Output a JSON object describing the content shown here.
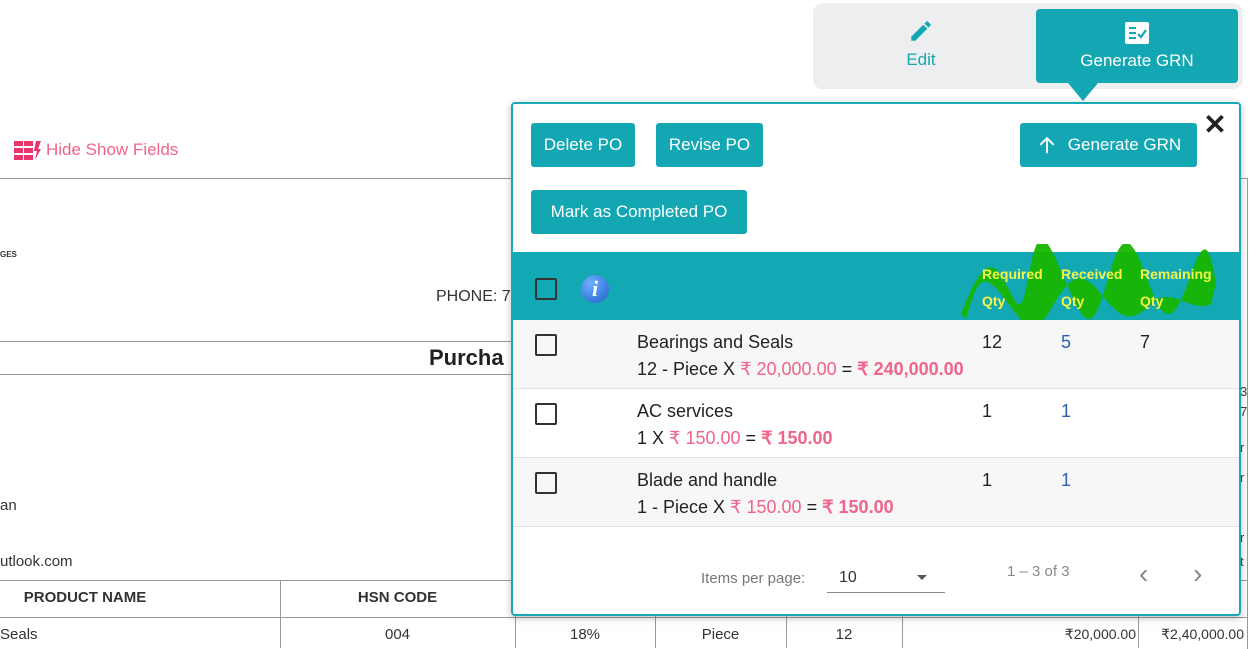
{
  "top_actions": {
    "edit_label": "Edit",
    "generate_label": "Generate GRN"
  },
  "document": {
    "hide_show_label": "Hide Show Fields",
    "tiny_text": "GES",
    "phone_label": "PHONE: 7",
    "title_partial": "Purcha",
    "line_an": "an",
    "line_email": "utlook.com",
    "columns": [
      "PRODUCT NAME",
      "HSN CODE"
    ],
    "row": {
      "name": "Seals",
      "hsn": "004",
      "tax": "18%",
      "unit": "Piece",
      "qty": "12",
      "rate": "₹20,000.00",
      "amount": "₹2,40,000.00"
    },
    "right_edge_chars": [
      "3",
      "7",
      "r",
      "r",
      "r",
      "t"
    ]
  },
  "popover": {
    "buttons": {
      "delete": "Delete PO",
      "revise": "Revise PO",
      "generate": "Generate GRN",
      "mark_completed": "Mark as Completed PO"
    },
    "close_symbol": "✕",
    "info_symbol": "i",
    "headers": {
      "required": [
        "Required",
        "Qty"
      ],
      "received": [
        "Received",
        "Qty"
      ],
      "remaining": [
        "Remaining",
        "Qty"
      ]
    },
    "rows": [
      {
        "name": "Bearings and Seals",
        "qty_prefix": "12 - Piece X ",
        "rate": "₹ 20,000.00",
        "equals": " = ",
        "total": "₹ 240,000.00",
        "required": "12",
        "received": "5",
        "remaining": "7"
      },
      {
        "name": "AC services",
        "qty_prefix": "1 X ",
        "rate": "₹ 150.00",
        "equals": " = ",
        "total": "₹ 150.00",
        "required": "1",
        "received": "1",
        "remaining": ""
      },
      {
        "name": "Blade and handle",
        "qty_prefix": "1 - Piece X ",
        "rate": "₹ 150.00",
        "equals": " = ",
        "total": "₹ 150.00",
        "required": "1",
        "received": "1",
        "remaining": ""
      }
    ],
    "paginator": {
      "items_per_page_label": "Items per page:",
      "page_size": "10",
      "range_label": "1 – 3 of 3",
      "prev_symbol": "‹",
      "next_symbol": "›"
    }
  },
  "colors": {
    "teal": "#13a7b4",
    "pink": "#f0648a",
    "header_text": "#f5f54a",
    "scribble": "#18b400",
    "received_blue": "#2b5fb0"
  }
}
